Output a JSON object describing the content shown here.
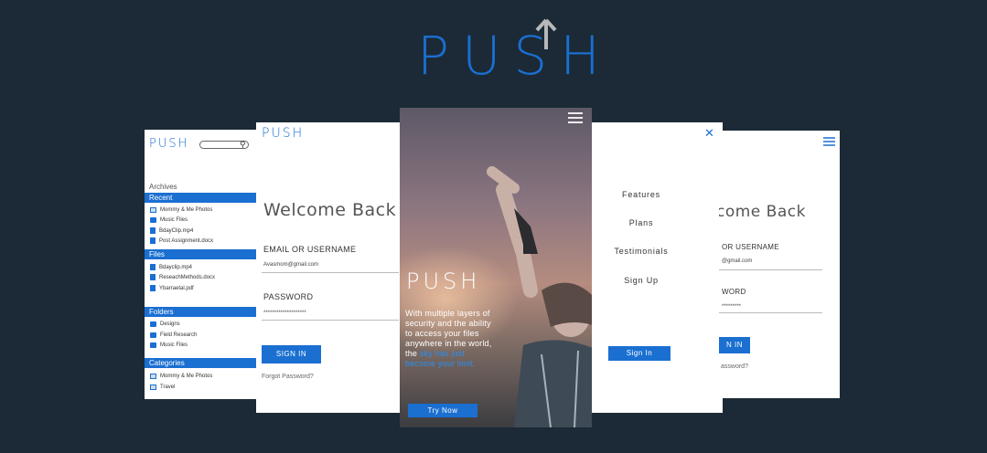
{
  "brand": {
    "name": "PUSH"
  },
  "browser": {
    "sections": {
      "archives": "Archives",
      "recent": "Recent",
      "files": "Files",
      "folders": "Folders",
      "categories": "Categories"
    },
    "recent_items": [
      "Mommy & Me Photos",
      "Music Files",
      "BdayClip.mp4",
      "Post Assignment.docx"
    ],
    "file_items": [
      "Bdayclip.mp4",
      "ReseachMethods.docx",
      "Ybarraetal.pdf"
    ],
    "folder_items": [
      "Designs",
      "Field Research",
      "Music Files"
    ],
    "category_items": [
      "Mommy & Me Photos",
      "Travel"
    ]
  },
  "login": {
    "title": "Welcome Back",
    "email_label": "EMAIL OR USERNAME",
    "email_value": "Avasmom@gmail.com",
    "password_label": "PASSWORD",
    "password_value": "********************",
    "signin_label": "SIGN IN",
    "forgot_label": "Forgot Password?"
  },
  "hero": {
    "text_main": "With multiple layers of security and the ability to access your files anywhere in the world, the ",
    "text_highlight": "sky has just become your limit.",
    "cta_label": "Try Now"
  },
  "nav_menu": {
    "items": [
      "Features",
      "Plans",
      "Testimonials",
      "Sign Up"
    ],
    "signin_label": "Sign In"
  },
  "login_partial": {
    "title": "come Back",
    "email_label": "OR USERNAME",
    "email_value": "@gmail.com",
    "password_label": "WORD",
    "password_value": "*********",
    "signin_label": "N IN",
    "forgot_label": "assword?"
  },
  "colors": {
    "background": "#1b2a36",
    "brand_blue": "#1a6fd1",
    "highlight_blue": "#2a8ff0"
  }
}
